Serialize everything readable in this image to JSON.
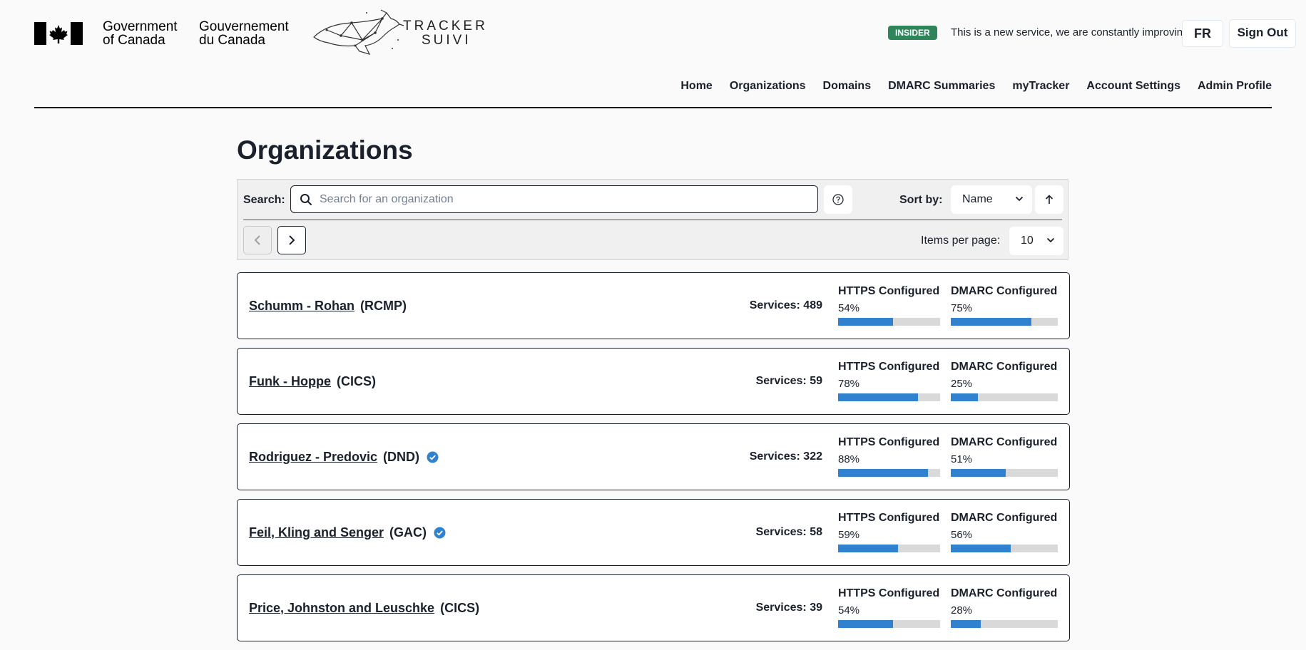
{
  "header": {
    "goc_en_line1": "Government",
    "goc_en_line2": "of Canada",
    "goc_fr_line1": "Gouvernement",
    "goc_fr_line2": "du Canada",
    "tracker_en": "TRACKER",
    "tracker_fr": "SUIVI",
    "badge": "INSIDER",
    "notice": "This is a new service, we are constantly improving.",
    "lang_button": "FR",
    "signout_button": "Sign Out"
  },
  "nav": {
    "items": [
      "Home",
      "Organizations",
      "Domains",
      "DMARC Summaries",
      "myTracker",
      "Account Settings",
      "Admin Profile"
    ]
  },
  "page": {
    "title": "Organizations"
  },
  "search": {
    "label": "Search:",
    "placeholder": "Search for an organization",
    "value": "",
    "sort_label": "Sort by:",
    "sort_value": "Name",
    "items_per_page_label": "Items per page:",
    "items_per_page_value": "10"
  },
  "org_list": {
    "services_prefix": "Services: ",
    "https_label": "HTTPS Configured",
    "dmarc_label": "DMARC Configured",
    "items": [
      {
        "name": "Schumm - Rohan",
        "acronym": "(RCMP)",
        "verified": false,
        "services": "489",
        "https_pct": 54,
        "dmarc_pct": 75
      },
      {
        "name": "Funk - Hoppe",
        "acronym": "(CICS)",
        "verified": false,
        "services": "59",
        "https_pct": 78,
        "dmarc_pct": 25
      },
      {
        "name": "Rodriguez - Predovic",
        "acronym": "(DND)",
        "verified": true,
        "services": "322",
        "https_pct": 88,
        "dmarc_pct": 51
      },
      {
        "name": "Feil, Kling and Senger",
        "acronym": "(GAC)",
        "verified": true,
        "services": "58",
        "https_pct": 59,
        "dmarc_pct": 56
      },
      {
        "name": "Price, Johnston and Leuschke",
        "acronym": "(CICS)",
        "verified": false,
        "services": "39",
        "https_pct": 54,
        "dmarc_pct": 28
      }
    ]
  },
  "colors": {
    "progress_fill": "#3182ce",
    "progress_track": "#d9d9d9",
    "insider_badge": "#2f855a",
    "verified": "#3182ce"
  }
}
